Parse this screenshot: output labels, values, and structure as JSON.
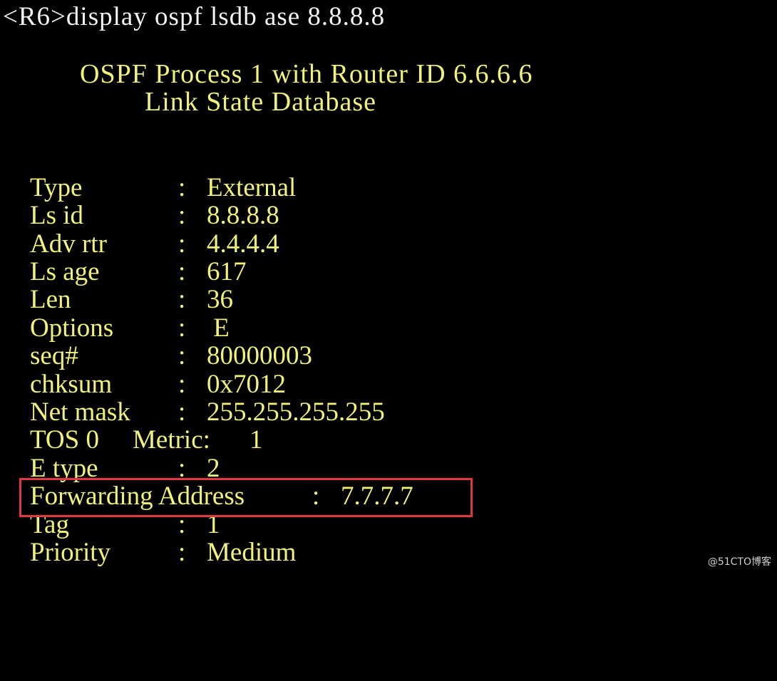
{
  "terminal": {
    "prompt": "<R6>display ospf lsdb ase 8.8.8.8",
    "title_line1": "OSPF Process 1 with Router ID 6.6.6.6",
    "title_line2": "Link State Database",
    "fields": [
      {
        "label": "Type",
        "colon": ":",
        "value": "External"
      },
      {
        "label": "Ls id",
        "colon": ":",
        "value": "8.8.8.8"
      },
      {
        "label": "Adv rtr",
        "colon": ":",
        "value": "4.4.4.4"
      },
      {
        "label": "Ls age",
        "colon": ":",
        "value": "617"
      },
      {
        "label": "Len",
        "colon": ":",
        "value": "36"
      },
      {
        "label": "Options",
        "colon": ":",
        "value": " E"
      },
      {
        "label": "seq#",
        "colon": ":",
        "value": "80000003"
      },
      {
        "label": "chksum",
        "colon": ":",
        "value": "0x7012"
      },
      {
        "label": "Net mask",
        "colon": ":",
        "value": "255.255.255.255"
      }
    ],
    "tos": {
      "label": "TOS 0",
      "metric_label": "Metric:",
      "metric_value": "1"
    },
    "etype": {
      "label": "E type",
      "colon": ":",
      "value": "2"
    },
    "forwarding": {
      "label": "Forwarding Address",
      "colon": ":",
      "value": "7.7.7.7"
    },
    "tag": {
      "label": "Tag",
      "colon": ":",
      "value": "1"
    },
    "priority": {
      "label": "Priority",
      "colon": ":",
      "value": "Medium"
    }
  },
  "watermark": "@51CTO博客",
  "colors": {
    "background": "#000000",
    "text_yellow": "#f2f27a",
    "prompt_white": "#f4f4f0",
    "highlight_red": "#e0383c"
  }
}
